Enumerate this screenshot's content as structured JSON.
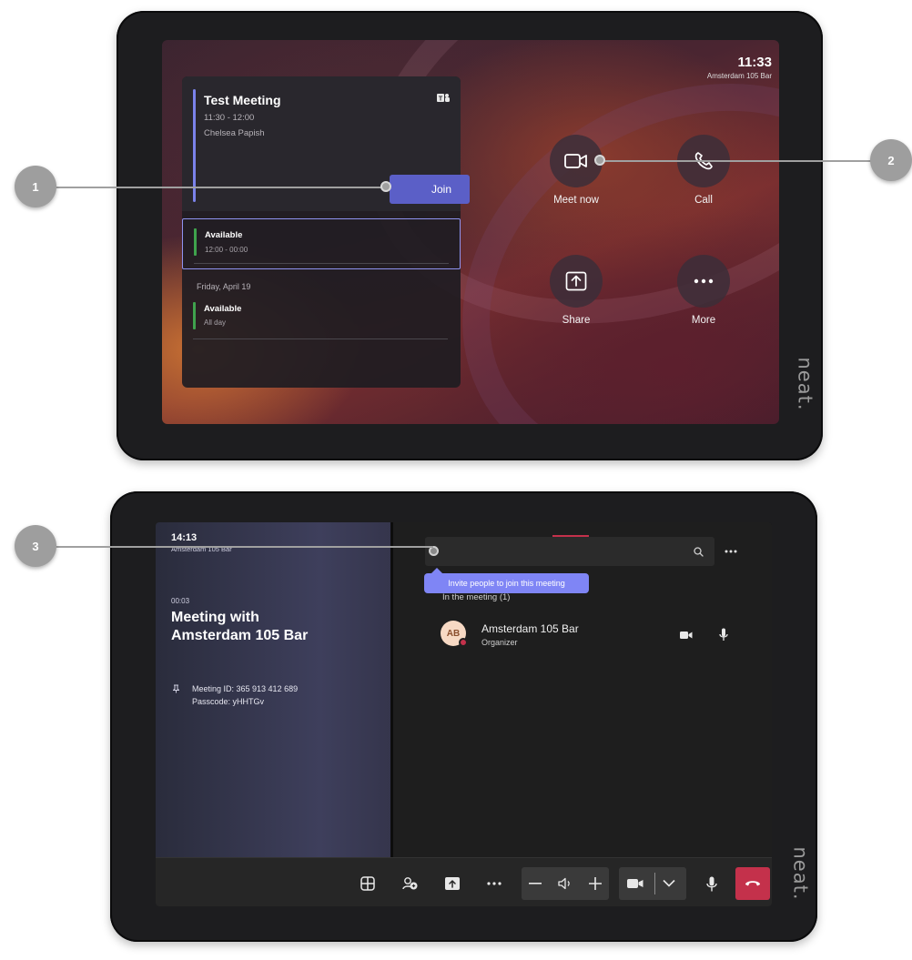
{
  "screen1": {
    "clock": {
      "time": "11:33",
      "room": "Amsterdam 105 Bar"
    },
    "meeting": {
      "title": "Test Meeting",
      "time": "11:30 - 12:00",
      "organizer": "Chelsea Papish",
      "join_label": "Join"
    },
    "availability": [
      {
        "label": "Available",
        "time": "12:00 - 00:00"
      },
      {
        "label": "Available",
        "time": "All day"
      }
    ],
    "day_header": "Friday, April 19",
    "actions": {
      "meet_now": "Meet now",
      "call": "Call",
      "share": "Share",
      "more": "More"
    }
  },
  "screen2": {
    "clock": {
      "time": "14:13",
      "room": "Amsterdam 105 Bar"
    },
    "elapsed": "00:03",
    "meeting_title_line1": "Meeting with",
    "meeting_title_line2": "Amsterdam 105 Bar",
    "meeting_id": "Meeting ID: 365 913 412 689",
    "passcode": "Passcode: yHHTGv",
    "tooltip": "Invite people to join this meeting",
    "in_meeting": "In the meeting (1)",
    "participant": {
      "initials": "AB",
      "name": "Amsterdam 105 Bar",
      "role": "Organizer"
    }
  },
  "brand": "neat.",
  "callouts": [
    "1",
    "2",
    "3"
  ],
  "colors": {
    "accent": "#5b5fc7",
    "tooltip": "#7f85f5",
    "available": "#3fa34d",
    "hangup": "#c4314b"
  }
}
